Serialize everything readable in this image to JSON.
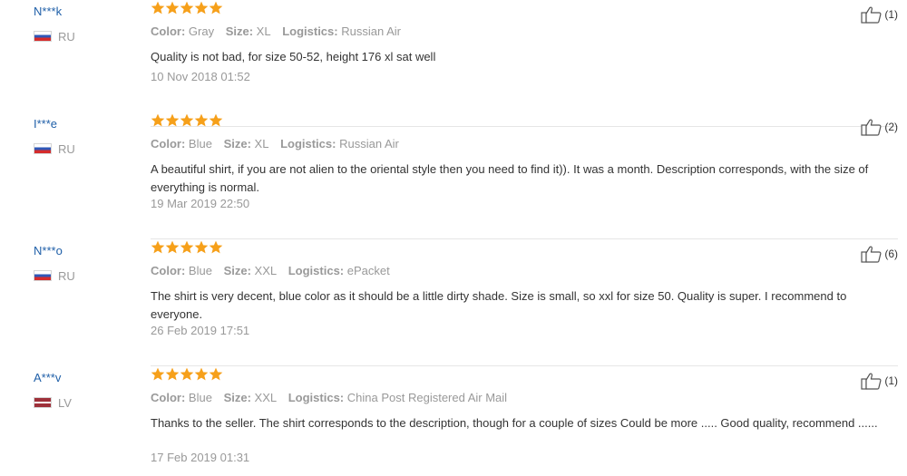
{
  "colors": {
    "star": "#f6a01a",
    "username": "#1f5fa8",
    "meta": "#999999",
    "text": "#333333"
  },
  "labels": {
    "color": "Color:",
    "size": "Size:",
    "logistics": "Logistics:"
  },
  "reviews": [
    {
      "user": "N***k",
      "country": "RU",
      "flag": "russia-flag-icon",
      "rating": 5,
      "color": "Gray",
      "size": "XL",
      "logistics": "Russian Air",
      "text": "Quality is not bad, for size 50-52, height 176 xl sat well",
      "date": "10 Nov 2018 01:52",
      "helpful": "(1)"
    },
    {
      "user": "I***e",
      "country": "RU",
      "flag": "russia-flag-icon",
      "rating": 5,
      "color": "Blue",
      "size": "XL",
      "logistics": "Russian Air",
      "text": "A beautiful shirt, if you are not alien to the oriental style then you need to find it)). It was a month. Description corresponds, with the size of everything is normal.",
      "date": "19 Mar 2019 22:50",
      "helpful": "(2)"
    },
    {
      "user": "N***o",
      "country": "RU",
      "flag": "russia-flag-icon",
      "rating": 5,
      "color": "Blue",
      "size": "XXL",
      "logistics": "ePacket",
      "text": "The shirt is very decent, blue color as it should be a little dirty shade. Size is small, so xxl for size 50. Quality is super. I recommend to everyone.",
      "date": "26 Feb 2019 17:51",
      "helpful": "(6)"
    },
    {
      "user": "A***v",
      "country": "LV",
      "flag": "latvia-flag-icon",
      "rating": 5,
      "color": "Blue",
      "size": "XXL",
      "logistics": "China Post Registered Air Mail",
      "text": "Thanks to the seller. The shirt corresponds to the description, though for a couple of sizes Could be more ..... Good quality, recommend ......",
      "date": "17 Feb 2019 01:31",
      "helpful": "(1)"
    }
  ]
}
